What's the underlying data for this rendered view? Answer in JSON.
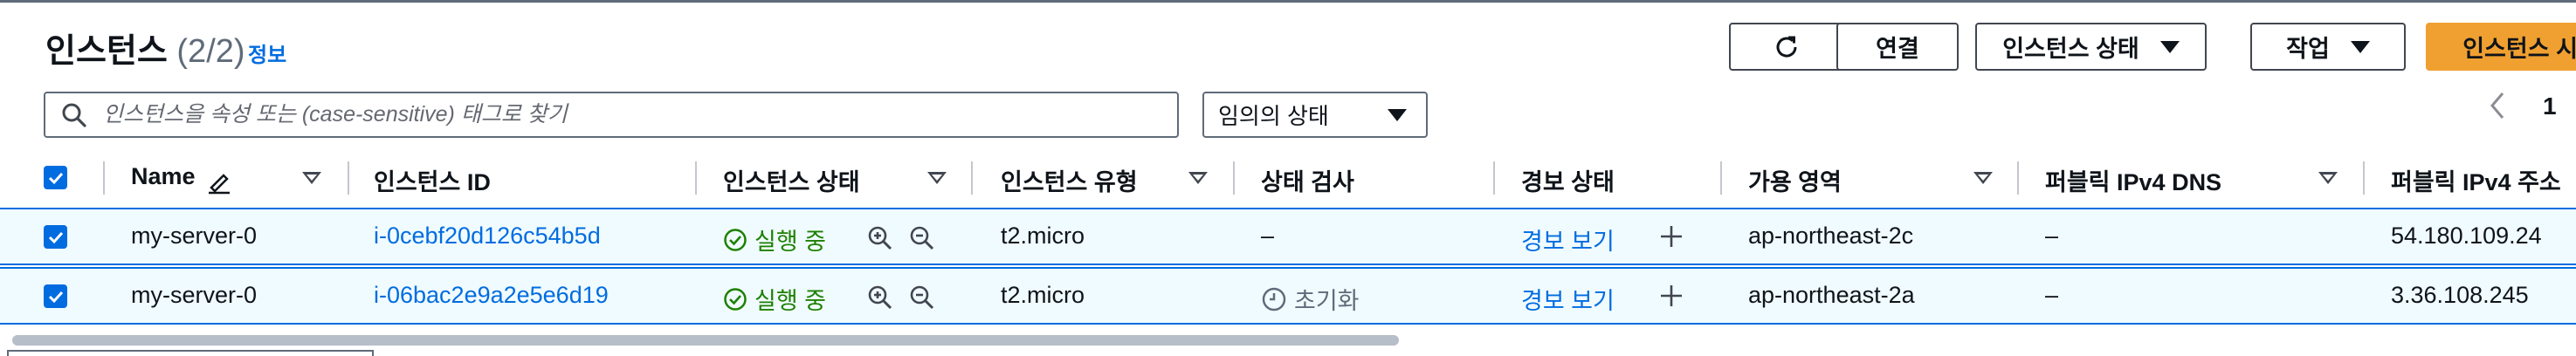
{
  "header": {
    "title": "인스턴스",
    "count": "(2/2)",
    "info": "정보",
    "buttons": {
      "connect": "연결",
      "instance_state": "인스턴스 상태",
      "actions": "작업",
      "launch": "인스턴스 시작"
    },
    "icons": {
      "refresh": "refresh-icon",
      "caret": "caret-down-icon"
    }
  },
  "search": {
    "placeholder": "인스턴스을 속성 또는 (case-sensitive) 태그로 찾기",
    "value": ""
  },
  "state_filter": {
    "selected": "임의의 상태"
  },
  "pagination": {
    "page": "1"
  },
  "table": {
    "columns": {
      "name": "Name",
      "instance_id": "인스턴스 ID",
      "instance_state": "인스턴스 상태",
      "instance_type": "인스턴스 유형",
      "status_check": "상태 검사",
      "alarm_status": "경보 상태",
      "availability_zone": "가용 영역",
      "public_dns": "퍼블릭 IPv4 DNS",
      "public_ip": "퍼블릭 IPv4 주소"
    },
    "rows": [
      {
        "name": "my-server-0",
        "instance_id": "i-0cebf20d126c54b5d",
        "state": "실행 중",
        "type": "t2.micro",
        "status_check": "–",
        "alarm": "경보 보기",
        "az": "ap-northeast-2c",
        "dns": "–",
        "ip": "54.180.109.24"
      },
      {
        "name": "my-server-0",
        "instance_id": "i-06bac2e9a2e5e6d19",
        "state": "실행 중",
        "type": "t2.micro",
        "status_check": "초기화",
        "alarm": "경보 보기",
        "az": "ap-northeast-2a",
        "dns": "–",
        "ip": "3.36.108.245"
      }
    ]
  },
  "colors": {
    "accent": "#006ce0",
    "primary_button": "#f0a030",
    "success": "#1d8102",
    "selected_row": "#f0fbff"
  }
}
